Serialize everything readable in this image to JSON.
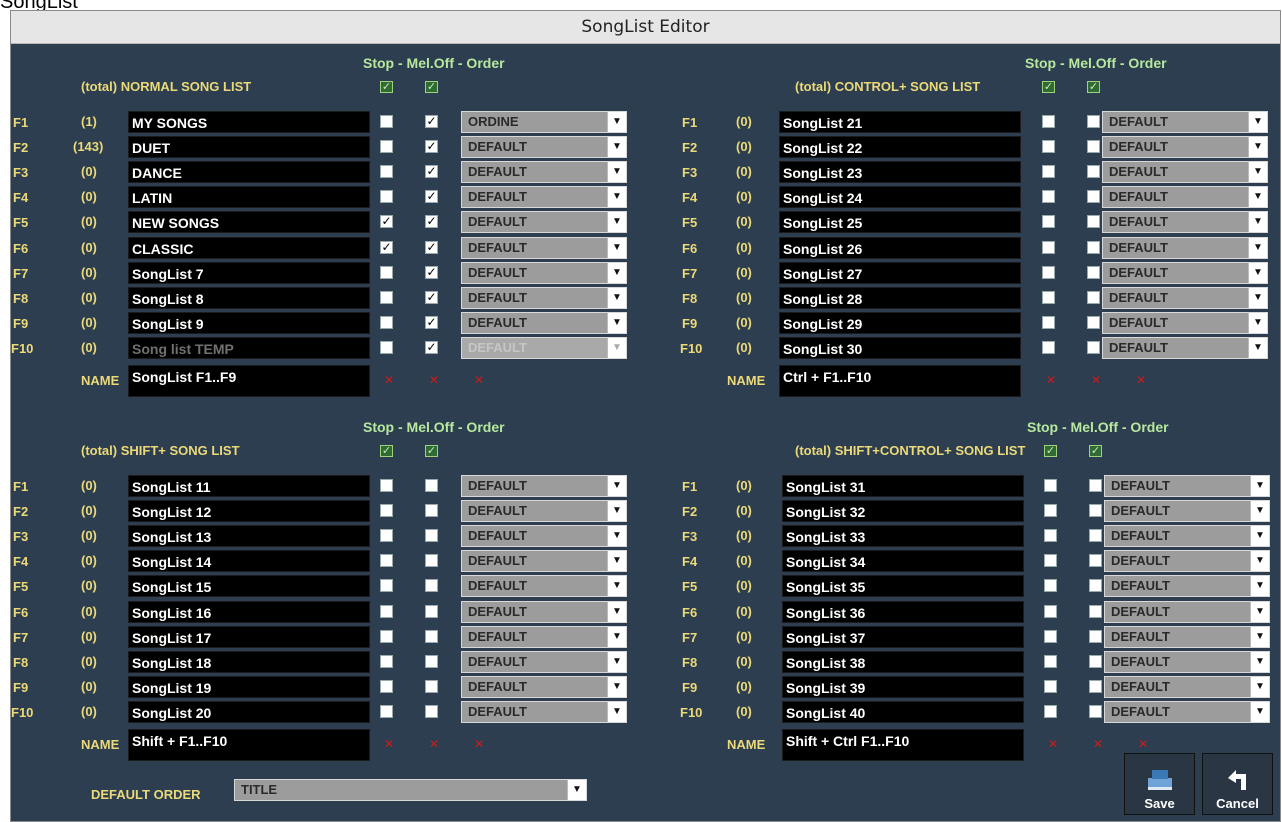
{
  "caption": "SongList",
  "window": {
    "title": "SongList Editor"
  },
  "header_labels": {
    "stop_mel_order": "Stop - Mel.Off - Order",
    "name_label": "NAME"
  },
  "panels": [
    {
      "title": "(total) NORMAL SONG LIST",
      "name_value": "SongList F1..F9",
      "rows": [
        {
          "key": "F1",
          "count": "(1)",
          "name": "MY SONGS",
          "stop": false,
          "meloff": true,
          "order": "ORDINE",
          "dim": false
        },
        {
          "key": "F2",
          "count": "(143)",
          "name": "DUET",
          "stop": false,
          "meloff": true,
          "order": "DEFAULT",
          "dim": false
        },
        {
          "key": "F3",
          "count": "(0)",
          "name": "DANCE",
          "stop": false,
          "meloff": true,
          "order": "DEFAULT",
          "dim": false
        },
        {
          "key": "F4",
          "count": "(0)",
          "name": "LATIN",
          "stop": false,
          "meloff": true,
          "order": "DEFAULT",
          "dim": false
        },
        {
          "key": "F5",
          "count": "(0)",
          "name": "NEW SONGS",
          "stop": true,
          "meloff": true,
          "order": "DEFAULT",
          "dim": false
        },
        {
          "key": "F6",
          "count": "(0)",
          "name": "CLASSIC",
          "stop": true,
          "meloff": true,
          "order": "DEFAULT",
          "dim": false
        },
        {
          "key": "F7",
          "count": "(0)",
          "name": "SongList 7",
          "stop": false,
          "meloff": true,
          "order": "DEFAULT",
          "dim": false
        },
        {
          "key": "F8",
          "count": "(0)",
          "name": "SongList 8",
          "stop": false,
          "meloff": true,
          "order": "DEFAULT",
          "dim": false
        },
        {
          "key": "F9",
          "count": "(0)",
          "name": "SongList 9",
          "stop": false,
          "meloff": true,
          "order": "DEFAULT",
          "dim": false
        },
        {
          "key": "F10",
          "count": "(0)",
          "name": "Song list TEMP",
          "stop": false,
          "meloff": true,
          "order": "DEFAULT",
          "dim": true
        }
      ]
    },
    {
      "title": "(total) CONTROL+ SONG LIST",
      "name_value": "Ctrl + F1..F10",
      "rows": [
        {
          "key": "F1",
          "count": "(0)",
          "name": "SongList 21",
          "stop": false,
          "meloff": false,
          "order": "DEFAULT",
          "dim": false
        },
        {
          "key": "F2",
          "count": "(0)",
          "name": "SongList 22",
          "stop": false,
          "meloff": false,
          "order": "DEFAULT",
          "dim": false
        },
        {
          "key": "F3",
          "count": "(0)",
          "name": "SongList 23",
          "stop": false,
          "meloff": false,
          "order": "DEFAULT",
          "dim": false
        },
        {
          "key": "F4",
          "count": "(0)",
          "name": "SongList 24",
          "stop": false,
          "meloff": false,
          "order": "DEFAULT",
          "dim": false
        },
        {
          "key": "F5",
          "count": "(0)",
          "name": "SongList 25",
          "stop": false,
          "meloff": false,
          "order": "DEFAULT",
          "dim": false
        },
        {
          "key": "F6",
          "count": "(0)",
          "name": "SongList 26",
          "stop": false,
          "meloff": false,
          "order": "DEFAULT",
          "dim": false
        },
        {
          "key": "F7",
          "count": "(0)",
          "name": "SongList 27",
          "stop": false,
          "meloff": false,
          "order": "DEFAULT",
          "dim": false
        },
        {
          "key": "F8",
          "count": "(0)",
          "name": "SongList 28",
          "stop": false,
          "meloff": false,
          "order": "DEFAULT",
          "dim": false
        },
        {
          "key": "F9",
          "count": "(0)",
          "name": "SongList 29",
          "stop": false,
          "meloff": false,
          "order": "DEFAULT",
          "dim": false
        },
        {
          "key": "F10",
          "count": "(0)",
          "name": "SongList 30",
          "stop": false,
          "meloff": false,
          "order": "DEFAULT",
          "dim": false
        }
      ]
    },
    {
      "title": "(total) SHIFT+ SONG LIST",
      "name_value": "Shift + F1..F10",
      "rows": [
        {
          "key": "F1",
          "count": "(0)",
          "name": "SongList 11",
          "stop": false,
          "meloff": false,
          "order": "DEFAULT",
          "dim": false
        },
        {
          "key": "F2",
          "count": "(0)",
          "name": "SongList 12",
          "stop": false,
          "meloff": false,
          "order": "DEFAULT",
          "dim": false
        },
        {
          "key": "F3",
          "count": "(0)",
          "name": "SongList 13",
          "stop": false,
          "meloff": false,
          "order": "DEFAULT",
          "dim": false
        },
        {
          "key": "F4",
          "count": "(0)",
          "name": "SongList 14",
          "stop": false,
          "meloff": false,
          "order": "DEFAULT",
          "dim": false
        },
        {
          "key": "F5",
          "count": "(0)",
          "name": "SongList 15",
          "stop": false,
          "meloff": false,
          "order": "DEFAULT",
          "dim": false
        },
        {
          "key": "F6",
          "count": "(0)",
          "name": "SongList 16",
          "stop": false,
          "meloff": false,
          "order": "DEFAULT",
          "dim": false
        },
        {
          "key": "F7",
          "count": "(0)",
          "name": "SongList 17",
          "stop": false,
          "meloff": false,
          "order": "DEFAULT",
          "dim": false
        },
        {
          "key": "F8",
          "count": "(0)",
          "name": "SongList 18",
          "stop": false,
          "meloff": false,
          "order": "DEFAULT",
          "dim": false
        },
        {
          "key": "F9",
          "count": "(0)",
          "name": "SongList 19",
          "stop": false,
          "meloff": false,
          "order": "DEFAULT",
          "dim": false
        },
        {
          "key": "F10",
          "count": "(0)",
          "name": "SongList 20",
          "stop": false,
          "meloff": false,
          "order": "DEFAULT",
          "dim": false
        }
      ]
    },
    {
      "title": "(total) SHIFT+CONTROL+ SONG LIST",
      "name_value": "Shift + Ctrl F1..F10",
      "rows": [
        {
          "key": "F1",
          "count": "(0)",
          "name": "SongList 31",
          "stop": false,
          "meloff": false,
          "order": "DEFAULT",
          "dim": false
        },
        {
          "key": "F2",
          "count": "(0)",
          "name": "SongList 32",
          "stop": false,
          "meloff": false,
          "order": "DEFAULT",
          "dim": false
        },
        {
          "key": "F3",
          "count": "(0)",
          "name": "SongList 33",
          "stop": false,
          "meloff": false,
          "order": "DEFAULT",
          "dim": false
        },
        {
          "key": "F4",
          "count": "(0)",
          "name": "SongList 34",
          "stop": false,
          "meloff": false,
          "order": "DEFAULT",
          "dim": false
        },
        {
          "key": "F5",
          "count": "(0)",
          "name": "SongList 35",
          "stop": false,
          "meloff": false,
          "order": "DEFAULT",
          "dim": false
        },
        {
          "key": "F6",
          "count": "(0)",
          "name": "SongList 36",
          "stop": false,
          "meloff": false,
          "order": "DEFAULT",
          "dim": false
        },
        {
          "key": "F7",
          "count": "(0)",
          "name": "SongList 37",
          "stop": false,
          "meloff": false,
          "order": "DEFAULT",
          "dim": false
        },
        {
          "key": "F8",
          "count": "(0)",
          "name": "SongList 38",
          "stop": false,
          "meloff": false,
          "order": "DEFAULT",
          "dim": false
        },
        {
          "key": "F9",
          "count": "(0)",
          "name": "SongList 39",
          "stop": false,
          "meloff": false,
          "order": "DEFAULT",
          "dim": false
        },
        {
          "key": "F10",
          "count": "(0)",
          "name": "SongList 40",
          "stop": false,
          "meloff": false,
          "order": "DEFAULT",
          "dim": false
        }
      ]
    }
  ],
  "footer": {
    "default_order_label": "DEFAULT ORDER",
    "default_order_value": "TITLE",
    "save_label": "Save",
    "cancel_label": "Cancel"
  },
  "colors": {
    "background": "#2c3e50",
    "label_yellow": "#ecd978",
    "header_green": "#b7e89d",
    "x_red": "#d01a1a"
  }
}
